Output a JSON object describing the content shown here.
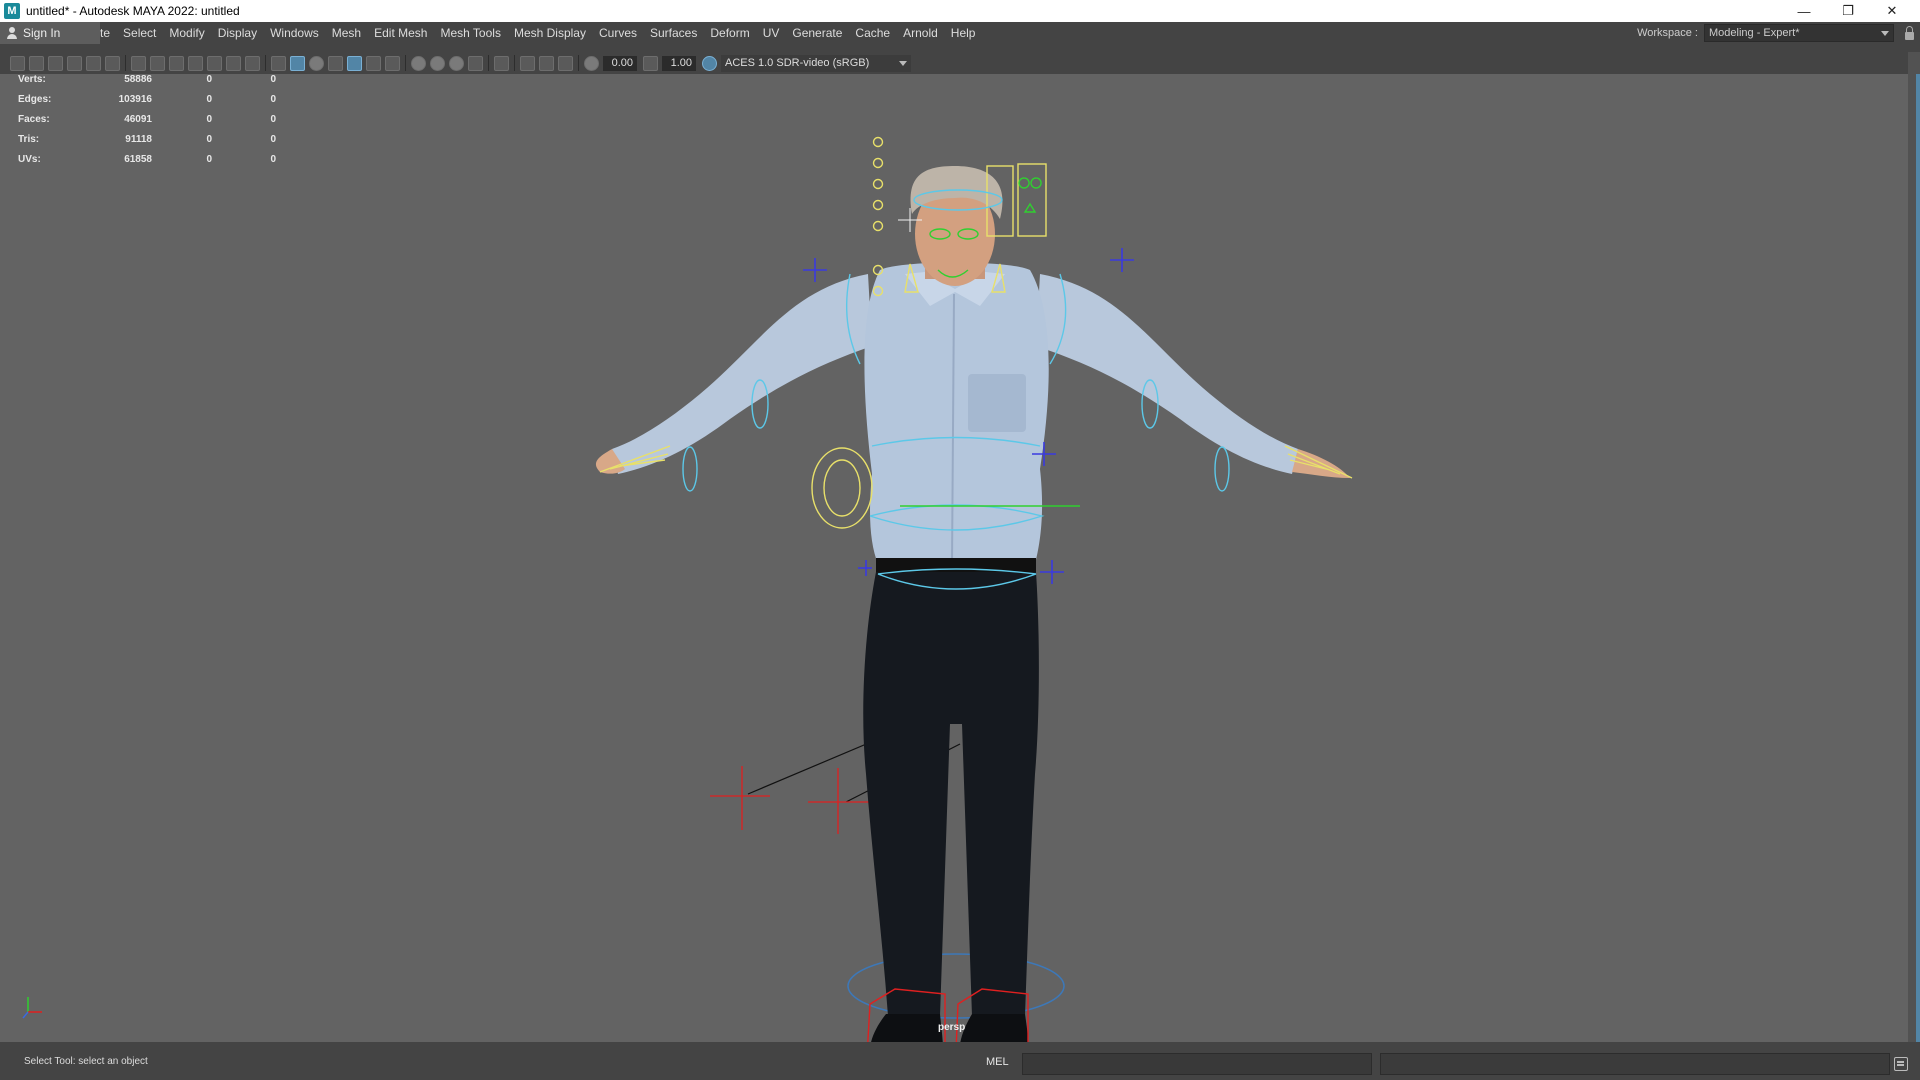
{
  "window": {
    "title": "untitled* - Autodesk MAYA 2022: untitled",
    "app_icon_glyph": "M",
    "minimize_glyph": "—",
    "restore_glyph": "❐",
    "close_glyph": "✕"
  },
  "menubar": {
    "sign_in": "Sign In",
    "partial_item": "te",
    "items": [
      "Select",
      "Modify",
      "Display",
      "Windows",
      "Mesh",
      "Edit Mesh",
      "Mesh Tools",
      "Mesh Display",
      "Curves",
      "Surfaces",
      "Deform",
      "UV",
      "Generate",
      "Cache",
      "Arnold",
      "Help"
    ]
  },
  "workspace": {
    "label": "Workspace :",
    "value": "Modeling - Expert*"
  },
  "viewport_toolbar": {
    "exposure": "0.00",
    "gamma": "1.00",
    "color_space": "ACES 1.0 SDR-video (sRGB)"
  },
  "heads_up": {
    "rows": [
      {
        "label": "Verts:",
        "v1": "58886",
        "v2": "0",
        "v3": "0"
      },
      {
        "label": "Edges:",
        "v1": "103916",
        "v2": "0",
        "v3": "0"
      },
      {
        "label": "Faces:",
        "v1": "46091",
        "v2": "0",
        "v3": "0"
      },
      {
        "label": "Tris:",
        "v1": "91118",
        "v2": "0",
        "v3": "0"
      },
      {
        "label": "UVs:",
        "v1": "61858",
        "v2": "0",
        "v3": "0"
      }
    ]
  },
  "camera": {
    "name": "persp"
  },
  "statusbar": {
    "help_text": "Select Tool: select an object",
    "mel_label": "MEL"
  },
  "colors": {
    "viewport_bg": "#636363",
    "ui_bg": "#444444",
    "selection_blue": "#5285a6",
    "rig_yellow": "#e8e06a",
    "rig_cyan": "#5cc8e8",
    "rig_blue": "#3a3ae0",
    "rig_red": "#e02020",
    "rig_green": "#30d030"
  }
}
